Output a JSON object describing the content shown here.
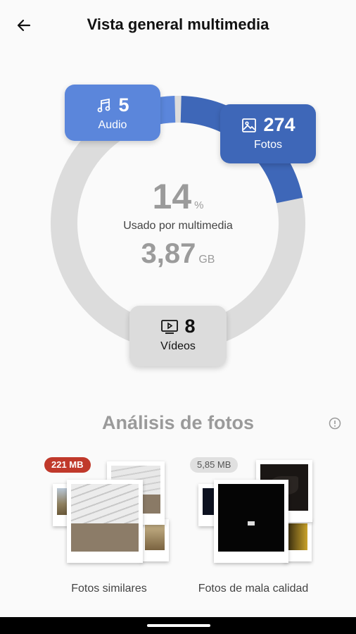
{
  "header": {
    "title": "Vista general multimedia",
    "back_icon": "arrow-left-icon"
  },
  "usage": {
    "percent": "14",
    "percent_unit": "%",
    "label": "Usado por multimedia",
    "size": "3,87",
    "size_unit": "GB",
    "fraction_used": 0.14
  },
  "categories": {
    "audio": {
      "count": "5",
      "label": "Audio",
      "icon": "music-note-icon",
      "color": "#5b86db"
    },
    "fotos": {
      "count": "274",
      "label": "Fotos",
      "icon": "image-icon",
      "color": "#3e67b8"
    },
    "videos": {
      "count": "8",
      "label": "Vídeos",
      "icon": "video-play-icon",
      "color": "#dcdcdc"
    }
  },
  "analysis": {
    "title": "Análisis de fotos",
    "info_icon": "info-icon",
    "similar": {
      "badge": "221 MB",
      "caption": "Fotos similares",
      "badge_color": "#c0392b"
    },
    "low_quality": {
      "badge": "5,85 MB",
      "caption": "Fotos de mala calidad"
    }
  }
}
